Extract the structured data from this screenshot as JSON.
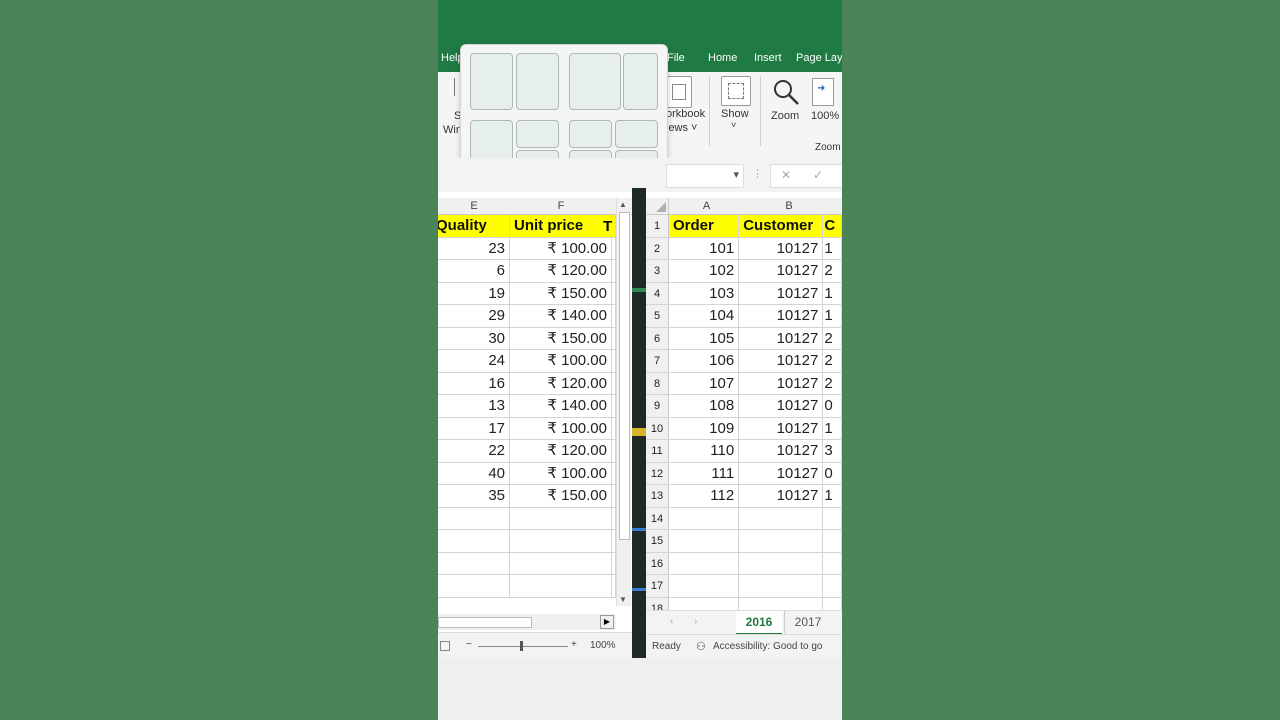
{
  "ribbon": {
    "tabs": [
      "Help",
      "File",
      "Home",
      "Insert",
      "Page Layo"
    ],
    "workbook_views_label": [
      "orkbook",
      "iews ˅"
    ],
    "show_label": "Show",
    "zoom_label": "Zoom",
    "zoom100_label": "100%",
    "zoom_group_label": "Zoom",
    "window_fragment": [
      "S",
      "Win"
    ]
  },
  "formula_bar": {
    "cancel_icon": "✕",
    "enter_icon": "✓",
    "dropdown_icon": "▾"
  },
  "left_pane": {
    "columns": [
      "E",
      "F"
    ],
    "headers": [
      "Quality",
      "Unit price",
      "T"
    ],
    "rows": [
      [
        "23",
        "₹ 100.00"
      ],
      [
        "6",
        "₹ 120.00"
      ],
      [
        "19",
        "₹ 150.00"
      ],
      [
        "29",
        "₹ 140.00"
      ],
      [
        "30",
        "₹ 150.00"
      ],
      [
        "24",
        "₹ 100.00"
      ],
      [
        "16",
        "₹ 120.00"
      ],
      [
        "13",
        "₹ 140.00"
      ],
      [
        "17",
        "₹ 100.00"
      ],
      [
        "22",
        "₹ 120.00"
      ],
      [
        "40",
        "₹ 100.00"
      ],
      [
        "35",
        "₹ 150.00"
      ]
    ],
    "zoom_minus": "−",
    "zoom_plus": "+",
    "zoom_level": "100%"
  },
  "right_pane": {
    "columns": [
      "A",
      "B"
    ],
    "row_numbers": [
      "1",
      "2",
      "3",
      "4",
      "5",
      "6",
      "7",
      "8",
      "9",
      "10",
      "11",
      "12",
      "13",
      "14",
      "15",
      "16",
      "17",
      "18"
    ],
    "headers": [
      "Order",
      "Customer",
      "C"
    ],
    "rows": [
      [
        "101",
        "10127"
      ],
      [
        "102",
        "10127"
      ],
      [
        "103",
        "10127"
      ],
      [
        "104",
        "10127"
      ],
      [
        "105",
        "10127"
      ],
      [
        "106",
        "10127"
      ],
      [
        "107",
        "10127"
      ],
      [
        "108",
        "10127"
      ],
      [
        "109",
        "10127"
      ],
      [
        "110",
        "10127"
      ],
      [
        "111",
        "10127"
      ],
      [
        "112",
        "10127"
      ]
    ],
    "right_edge_fragments": [
      "1",
      "2",
      "1",
      "1",
      "2",
      "2",
      "2",
      "0",
      "1",
      "3",
      "0",
      "1"
    ],
    "sheet_tabs": [
      "2016",
      "2017"
    ],
    "active_sheet": "2016",
    "status_ready": "Ready",
    "status_accessibility": "Accessibility: Good to go"
  },
  "colors": {
    "page_bg": "#4a8358",
    "ribbon_green": "#1f7a43",
    "header_yellow": "#ffff00",
    "active_tab": "#1f7a43"
  }
}
